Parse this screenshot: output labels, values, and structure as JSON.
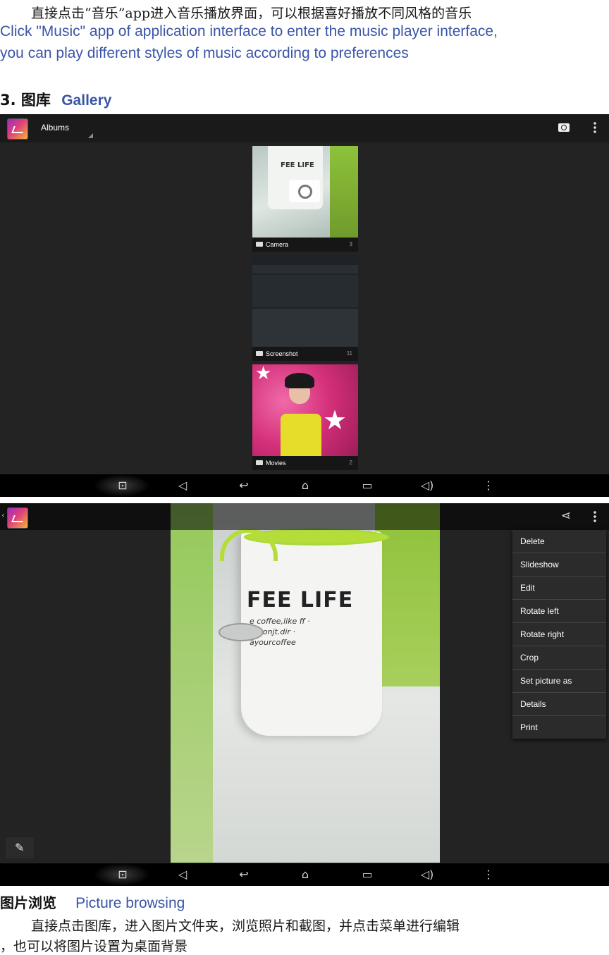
{
  "intro": {
    "cn": "直接点击“音乐”app进入音乐播放界面，可以根据喜好播放不同风格的音乐",
    "en_line1": "Click \"Music\" app of application interface to enter the music player interface,",
    "en_line2": "you can play different styles of music according to preferences"
  },
  "section": {
    "number": "3.",
    "title_cn": "图库",
    "title_en": "Gallery"
  },
  "gallery_screen": {
    "title": "Albums",
    "albums": [
      {
        "name": "Camera",
        "count": "3"
      },
      {
        "name": "Screenshot",
        "count": "11"
      },
      {
        "name": "Movies",
        "count": "2"
      }
    ],
    "photo_text": "FEE LIFE"
  },
  "picture_screen": {
    "menu": [
      "Delete",
      "Slideshow",
      "Edit",
      "Rotate left",
      "Rotate right",
      "Crop",
      "Set picture as",
      "Details",
      "Print"
    ],
    "mug_text": "FEE LIFE",
    "mug_script": "e coffee,like ff · Tooonjt.dir · ayourcoffee"
  },
  "caption": {
    "cn": "图片浏览",
    "en": "Picture browsing",
    "desc_line1": "直接点击图库，进入图片文件夹，浏览照片和截图，并点击菜单进行编辑",
    "desc_line2": "，也可以将图片设置为桌面背景"
  },
  "icons": [
    "camera-icon",
    "overflow-menu-icon",
    "folder-icon",
    "share-icon",
    "pencil-icon",
    "volume-down-icon",
    "back-icon",
    "home-icon",
    "recents-icon",
    "volume-up-icon",
    "screenshot-icon"
  ],
  "colors": {
    "english_text": "#3a55a8",
    "photo_accent": "#a8d93a",
    "movies_bg": "#e0357f"
  }
}
